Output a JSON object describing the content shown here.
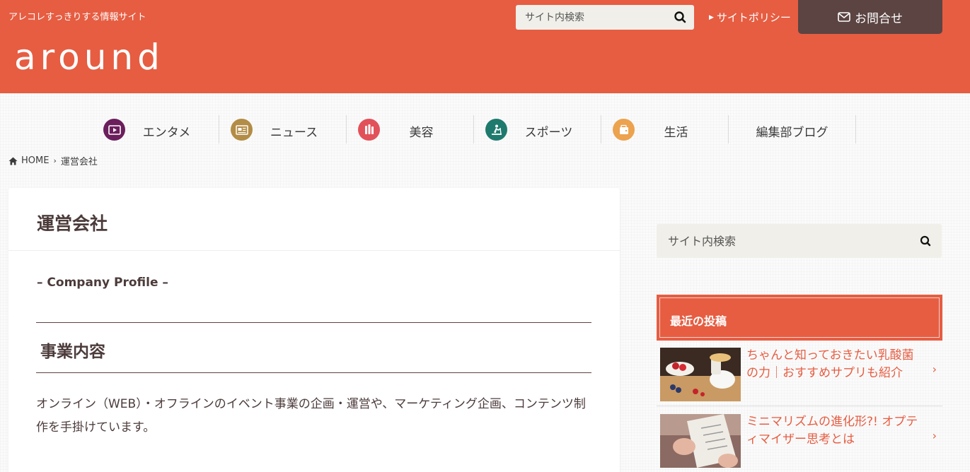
{
  "header": {
    "tagline": "アレコレすっきりする情報サイト",
    "logo": "around",
    "search_placeholder": "サイト内検索",
    "policy_link": "サイトポリシー",
    "contact_label": "お問合せ"
  },
  "nav": {
    "items": [
      {
        "label": "エンタメ",
        "icon": "video-icon",
        "color": "#6b1f5c"
      },
      {
        "label": "ニュース",
        "icon": "newspaper-icon",
        "color": "#b38c45"
      },
      {
        "label": "美容",
        "icon": "cosmetics-icon",
        "color": "#e2515a"
      },
      {
        "label": "スポーツ",
        "icon": "treadmill-icon",
        "color": "#1f7a6e"
      },
      {
        "label": "生活",
        "icon": "wallet-icon",
        "color": "#eca24f"
      },
      {
        "label": "編集部ブログ",
        "icon": "",
        "color": ""
      }
    ]
  },
  "breadcrumb": {
    "home": "HOME",
    "current": "運営会社"
  },
  "main": {
    "title": "運営会社",
    "subtitle": "– Company Profile –",
    "section_heading": "事業内容",
    "body": "オンライン（WEB）・オフラインのイベント事業の企画・運営や、マーケティング企画、コンテンツ制作を手掛けています。"
  },
  "sidebar": {
    "search_placeholder": "サイト内検索",
    "widget_title": "最近の投稿",
    "posts": [
      {
        "title": "ちゃんと知っておきたい乳酸菌の力｜おすすめサプリも紹介"
      },
      {
        "title": "ミニマリズムの進化形?! オプティマイザー思考とは"
      }
    ]
  },
  "colors": {
    "accent": "#e65d42",
    "dark": "#5b4442",
    "text": "#4c3b3b"
  }
}
